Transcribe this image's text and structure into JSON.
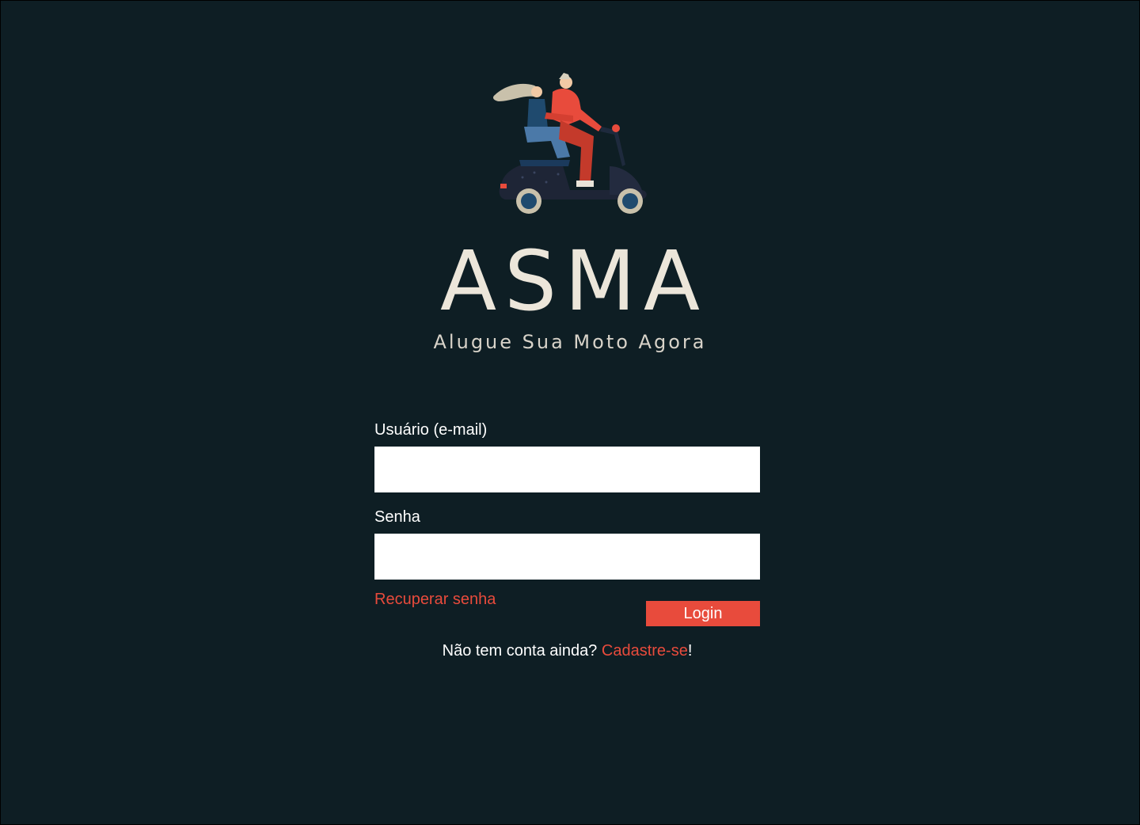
{
  "brand": {
    "title": "ASMA",
    "tagline": "Alugue Sua Moto Agora",
    "illustration": "couple-riding-scooter-illustration"
  },
  "form": {
    "email_label": "Usuário (e-mail)",
    "email_value": "",
    "password_label": "Senha",
    "password_value": "",
    "recover_link": "Recuperar senha",
    "login_button": "Login"
  },
  "signup": {
    "prompt": "Não tem conta ainda? ",
    "link": "Cadastre-se",
    "suffix": "!"
  },
  "colors": {
    "background": "#0e1e24",
    "accent": "#e84b3c",
    "brand_text": "#ece6da"
  }
}
